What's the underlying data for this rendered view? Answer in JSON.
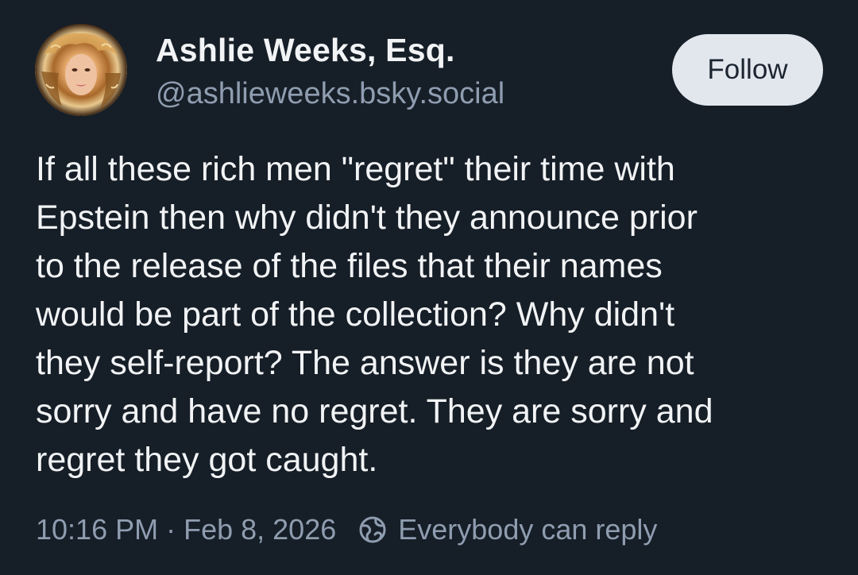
{
  "author": {
    "display_name": "Ashlie Weeks, Esq.",
    "handle": "@ashlieweeks.bsky.social"
  },
  "follow_label": "Follow",
  "post": {
    "lines": [
      "If all these rich men \"regret\" their time with",
      "Epstein then why didn't they announce prior",
      "to the release of the files that their names",
      "would be part of the collection? Why didn't",
      "they self-report? The answer is they are not",
      "sorry and have no regret. They are sorry and",
      "regret they got caught."
    ]
  },
  "meta": {
    "time": "10:16 PM",
    "separator": "·",
    "date": "Feb 8, 2026",
    "reply_setting_icon": "globe-icon",
    "reply_setting": "Everybody can reply"
  },
  "colors": {
    "background": "#161e27",
    "text": "#f1f3f5",
    "muted": "#8f9db0",
    "follow_button_bg": "#e2e7ee"
  }
}
